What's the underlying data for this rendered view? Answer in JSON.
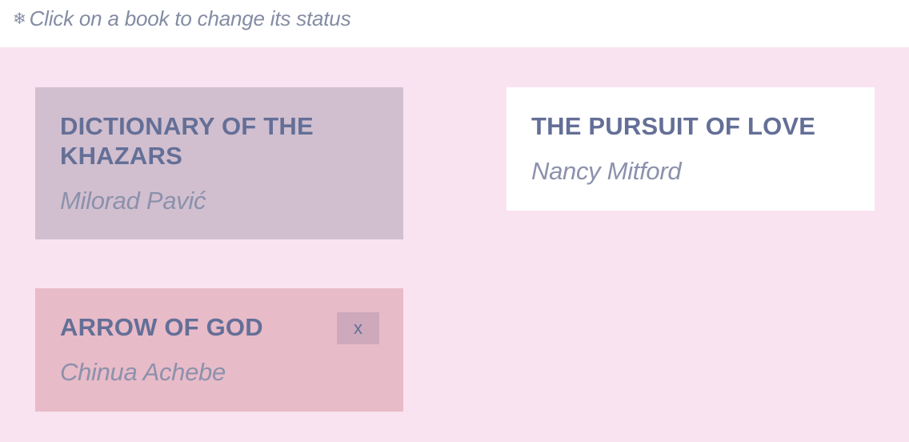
{
  "hint": {
    "icon": "snowflake-icon",
    "icon_glyph": "❄",
    "text": "Click on a book to change its status"
  },
  "books": [
    {
      "title": "DICTIONARY OF THE KHAZARS",
      "author": "Milorad Pavić",
      "color": "#d1bfcf"
    },
    {
      "title": "THE PURSUIT OF LOVE",
      "author": "Nancy Mitford",
      "color": "#ffffff"
    },
    {
      "title": "ARROW OF GOD",
      "author": "Chinua Achebe",
      "color": "#e8bbc8",
      "remove_label": "x"
    }
  ],
  "colors": {
    "board_background": "#f9e3f0",
    "title_text": "#646f97",
    "author_text": "#8c91ac",
    "hint_text": "#848ca4",
    "remove_button": "#cda9bb"
  }
}
